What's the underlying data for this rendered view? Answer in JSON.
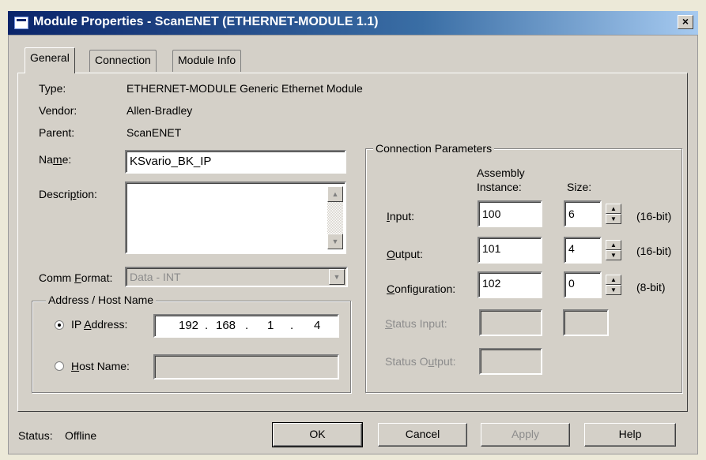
{
  "window": {
    "title": "Module Properties  - ScanENET (ETHERNET-MODULE 1.1)",
    "close_glyph": "×"
  },
  "tabs": [
    {
      "label": "General",
      "active": true
    },
    {
      "label": "Connection"
    },
    {
      "label": "Module Info"
    }
  ],
  "general": {
    "type_label": "Type:",
    "type_value": "ETHERNET-MODULE Generic Ethernet Module",
    "vendor_label": "Vendor:",
    "vendor_value": "Allen-Bradley",
    "parent_label": "Parent:",
    "parent_value": "ScanENET",
    "name_label_pre": "Na",
    "name_label_u": "m",
    "name_label_post": "e:",
    "name_value": "KSvario_BK_IP",
    "description_label_pre": "Descri",
    "description_label_u": "p",
    "description_label_post": "tion:",
    "description_value": "",
    "comm_format_label_pre": "Comm ",
    "comm_format_label_u": "F",
    "comm_format_label_post": "ormat:",
    "comm_format_value": "Data - INT"
  },
  "address": {
    "group_label": "Address / Host Name",
    "ip_label_pre": "IP ",
    "ip_label_u": "A",
    "ip_label_post": "ddress:",
    "ip_octets": [
      "192",
      "168",
      "1",
      "4"
    ],
    "ip_dot": ".",
    "host_label_pre": "",
    "host_label_u": "H",
    "host_label_post": "ost Name:",
    "host_value": "",
    "selected": "ip"
  },
  "connection": {
    "group_label": "Connection Parameters",
    "col_assembly_line1": "Assembly",
    "col_assembly_line2": "Instance:",
    "col_size": "Size:",
    "input": {
      "label_u": "I",
      "label_post": "nput:",
      "instance": "100",
      "size": "6",
      "unit": "(16-bit)"
    },
    "output": {
      "label_u": "O",
      "label_post": "utput:",
      "instance": "101",
      "size": "4",
      "unit": "(16-bit)"
    },
    "configuration": {
      "label_u": "C",
      "label_post": "onfiguration:",
      "instance": "102",
      "size": "0",
      "unit": "(8-bit)"
    },
    "status_input": {
      "label_u": "S",
      "label_post": "tatus Input:"
    },
    "status_output": {
      "label_pre": "Status O",
      "label_u": "u",
      "label_post": "tput:"
    }
  },
  "footer": {
    "status_label": "Status:",
    "status_value": "Offline",
    "ok": "OK",
    "cancel": "Cancel",
    "apply": "Apply",
    "help": "Help"
  },
  "icons": {
    "spin_up": "▲",
    "spin_down": "▼",
    "dropdown": "▼",
    "scroll_up": "▲",
    "scroll_down": "▼"
  },
  "colors": {
    "title_bar": "#0a246a",
    "dialog_bg": "#d4d0c8",
    "disabled_text": "#8c8c8c"
  }
}
